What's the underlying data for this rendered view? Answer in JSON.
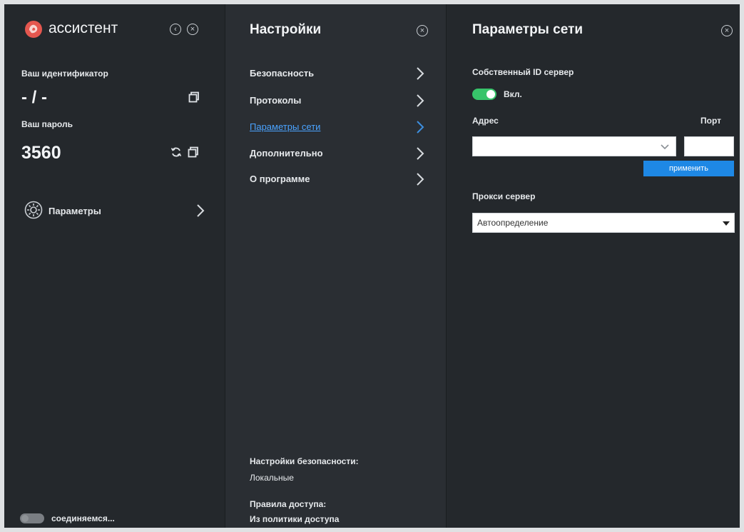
{
  "colors": {
    "panel_dark": "#24282c",
    "panel_mid": "#2a2e33",
    "accent_blue": "#1e88e5",
    "toggle_on": "#37c46a",
    "link_blue": "#4aa3ff"
  },
  "left": {
    "app_name": "ассистент",
    "id_label": "Ваш идентификатор",
    "id_value": "- / -",
    "password_label": "Ваш пароль",
    "password_value": "3560",
    "params_label": "Параметры",
    "status_text": "соединяемся..."
  },
  "middle": {
    "title": "Настройки",
    "menu": [
      {
        "label": "Безопасность"
      },
      {
        "label": "Протоколы"
      },
      {
        "label": "Параметры сети"
      },
      {
        "label": "Дополнительно"
      },
      {
        "label": "О программе"
      }
    ],
    "security_settings_label": "Настройки безопасности:",
    "security_settings_value": "Локальные",
    "access_rules_label": "Правила доступа:",
    "access_rules_value": "Из политики доступа"
  },
  "right": {
    "title": "Параметры сети",
    "own_server_label": "Собственный ID сервер",
    "toggle_label": "Вкл.",
    "address_label": "Адрес",
    "port_label": "Порт",
    "address_value": "",
    "port_value": "",
    "apply_button": "применить",
    "proxy_label": "Прокси сервер",
    "proxy_value": "Автоопределение"
  }
}
